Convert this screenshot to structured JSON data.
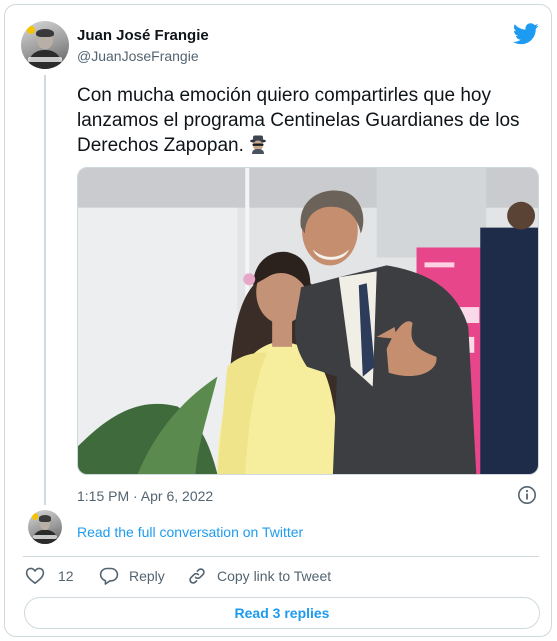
{
  "author": {
    "name": "Juan José Frangie",
    "handle": "@JuanJoseFrangie"
  },
  "tweet": {
    "text": "Con mucha emoción quiero compartirles que hoy lanzamos el programa Centinelas Guardianes de los Derechos Zapopan.",
    "emoji": "detective-emoji",
    "timestamp": "1:15 PM · Apr 6, 2022"
  },
  "conversation": {
    "read_full_label": "Read the full conversation on Twitter"
  },
  "actions": {
    "like_count": "12",
    "reply_label": "Reply",
    "copy_link_label": "Copy link to Tweet"
  },
  "footer": {
    "read_replies_label": "Read 3 replies"
  },
  "colors": {
    "twitter_blue": "#1d9bf0",
    "secondary_text": "#536471",
    "border": "#cfd9de"
  },
  "icons": {
    "brand": "twitter-bird-icon",
    "info": "info-icon",
    "like": "heart-icon",
    "reply": "speech-bubble-icon",
    "copy": "link-icon"
  }
}
